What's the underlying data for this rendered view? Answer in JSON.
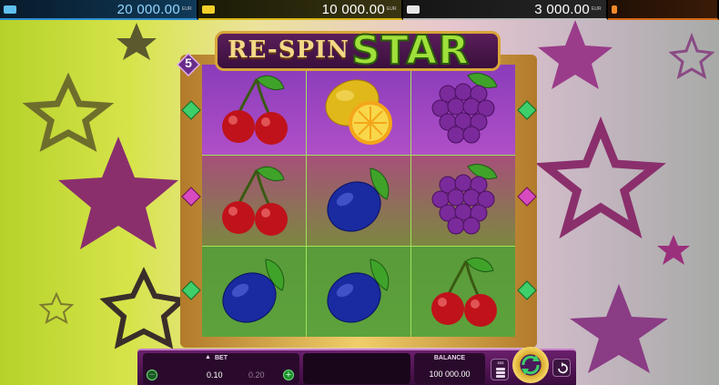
{
  "jackpots": [
    {
      "name": "jackpot-1",
      "value": "20 000.00",
      "currency": "EUR",
      "color": "#2f8fd0"
    },
    {
      "name": "jackpot-2",
      "value": "10 000.00",
      "currency": "EUR",
      "color": "#d9b81a"
    },
    {
      "name": "jackpot-3",
      "value": "3 000.00",
      "currency": "EUR",
      "color": "#bdbdbd"
    },
    {
      "name": "jackpot-4",
      "value": "",
      "currency": "",
      "color": "#d46a1a"
    }
  ],
  "logo": {
    "part1": "RE-SPIN",
    "part2": "STAR"
  },
  "lines_badge": "5",
  "reels": [
    [
      "cherry",
      "lemon",
      "grapes"
    ],
    [
      "cherry",
      "plum",
      "grapes"
    ],
    [
      "plum",
      "plum",
      "cherry"
    ]
  ],
  "controls": {
    "bet_label": "BET",
    "bet_up_arrow": "▲",
    "bet_value": "0.10",
    "bet_next_value": "0.20",
    "minus_icon": "−",
    "plus_icon": "+",
    "balance_label": "BALANCE",
    "balance_value": "100 000.00",
    "stake_label": "$$$",
    "spin_icon": "spin-arrows-icon",
    "autoplay_icon": "autoplay-icon"
  },
  "colors": {
    "accent_gold": "#d8a53a",
    "logo_green": "#9fe03a",
    "panel_purple": "#6a1f6c"
  }
}
